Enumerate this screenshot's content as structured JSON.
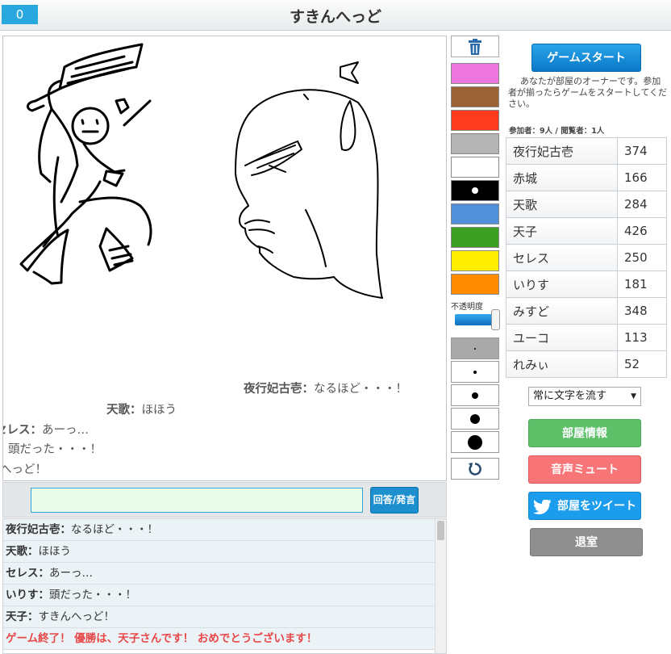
{
  "header": {
    "counter": "0",
    "title": "すきんへっど"
  },
  "canvas": {
    "flow_messages": [
      {
        "user": "夜行妃古壱",
        "text": "なるほど・・・！"
      },
      {
        "user": "天歌",
        "text": "ほほう"
      },
      {
        "user": "セレス",
        "text": "あーっ…"
      },
      {
        "user": "",
        "text": "頭だった・・・！"
      },
      {
        "user": "",
        "text": "へっど！"
      }
    ]
  },
  "input": {
    "value": "",
    "button_label": "回答/発言"
  },
  "chat_log": [
    {
      "user": "夜行妃古壱",
      "text": "なるほど・・・！"
    },
    {
      "user": "天歌",
      "text": "ほほう"
    },
    {
      "user": "セレス",
      "text": "あーっ…"
    },
    {
      "user": "いりす",
      "text": "頭だった・・・！"
    },
    {
      "user": "天子",
      "text": "すきんへっど！"
    },
    {
      "user": "",
      "text": "ゲーム終了！ 優勝は、天子さんです！ おめでとうございます！"
    }
  ],
  "tools": {
    "colors": [
      "#ee77dd",
      "#9b6437",
      "#ff3b1f",
      "#b4b4b4",
      "#ffffff",
      "#000000",
      "#5190d8",
      "#3a9f22",
      "#ffee00",
      "#ff8c00"
    ],
    "selected_color_index": 5,
    "opacity_label": "不透明度",
    "opacity_value": 0.9,
    "icons": {
      "clear": "trash-icon",
      "undo": "undo-icon"
    }
  },
  "right_panel": {
    "start_button": "ゲームスタート",
    "owner_note": "あなたが部屋のオーナーです。参加者が揃ったらゲームをスタートしてください。",
    "participants": "参加者：9人 / 閲覧者：1人",
    "scores": [
      {
        "name": "夜行妃古壱",
        "score": "374"
      },
      {
        "name": "赤城",
        "score": "166"
      },
      {
        "name": "天歌",
        "score": "284"
      },
      {
        "name": "天子",
        "score": "426"
      },
      {
        "name": "セレス",
        "score": "250"
      },
      {
        "name": "いりす",
        "score": "181"
      },
      {
        "name": "みすど",
        "score": "348"
      },
      {
        "name": "ユーコ",
        "score": "113"
      },
      {
        "name": "れみぃ",
        "score": "52"
      }
    ],
    "text_flow_select": "常に文字を流す",
    "room_info_button": "部屋情報",
    "mute_button": "音声ミュート",
    "tweet_button": "部屋をツイート",
    "leave_button": "退室"
  }
}
